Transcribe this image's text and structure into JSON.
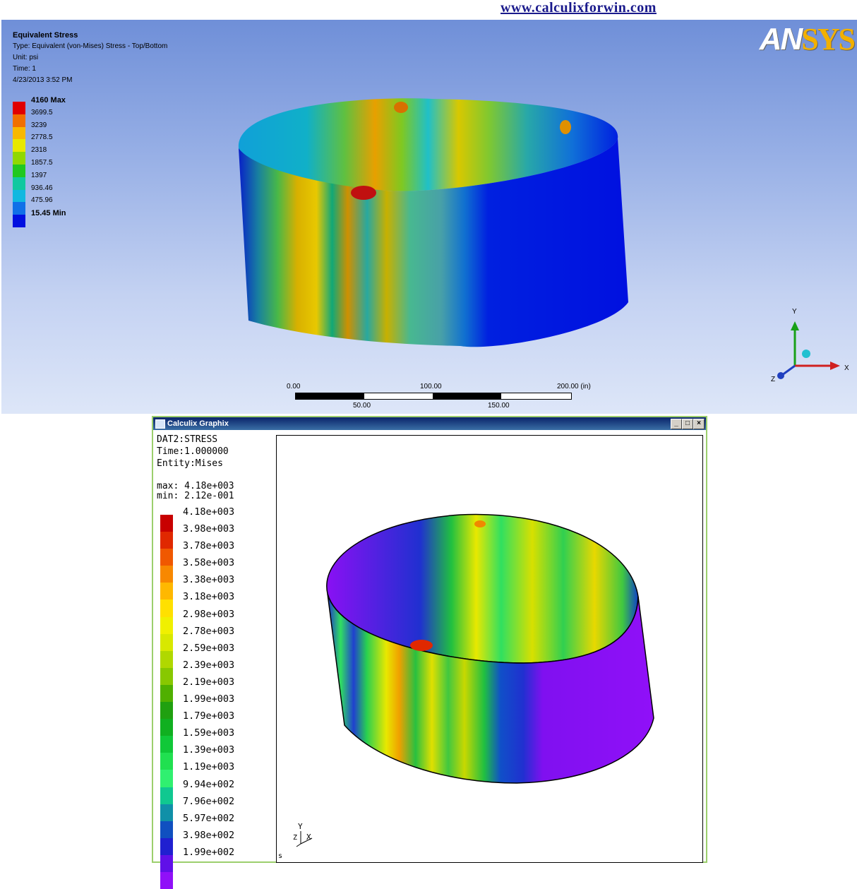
{
  "site_link": "www.calculixforwin.com",
  "ansys": {
    "title": "Equivalent Stress",
    "type_line": "Type: Equivalent (von-Mises) Stress - Top/Bottom",
    "unit_line": "Unit: psi",
    "time_line": "Time: 1",
    "date_line": "4/23/2013 3:52 PM",
    "logo_an": "AN",
    "logo_sys": "SYS",
    "legend": [
      {
        "label": "4160 Max",
        "color": "#e00000"
      },
      {
        "label": "3699.5",
        "color": "#f07000"
      },
      {
        "label": "3239",
        "color": "#f8b800"
      },
      {
        "label": "2778.5",
        "color": "#e8e800"
      },
      {
        "label": "2318",
        "color": "#90d800"
      },
      {
        "label": "1857.5",
        "color": "#20c820"
      },
      {
        "label": "1397",
        "color": "#10c8a0"
      },
      {
        "label": "936.46",
        "color": "#10b8e0"
      },
      {
        "label": "475.96",
        "color": "#1070e8"
      },
      {
        "label": "15.45 Min",
        "color": "#0010e0"
      }
    ],
    "scale": {
      "t0": "0.00",
      "t100": "100.00",
      "t200": "200.00 (in)",
      "t50": "50.00",
      "t150": "150.00"
    },
    "axis": {
      "x": "X",
      "y": "Y",
      "z": "Z"
    }
  },
  "calculix": {
    "window_title": "Calculix Graphix",
    "info_dataset": "DAT2:STRESS",
    "info_time": "Time:1.000000",
    "info_entity": "Entity:Mises",
    "max_line": "max: 4.18e+003",
    "min_line": "min: 2.12e-001",
    "legend": [
      {
        "label": "4.18e+003",
        "color": "#c80000"
      },
      {
        "label": "3.98e+003",
        "color": "#e02800"
      },
      {
        "label": "3.78e+003",
        "color": "#f05800"
      },
      {
        "label": "3.58e+003",
        "color": "#f88800"
      },
      {
        "label": "3.38e+003",
        "color": "#ffb800"
      },
      {
        "label": "3.18e+003",
        "color": "#ffe000"
      },
      {
        "label": "2.98e+003",
        "color": "#f0f000"
      },
      {
        "label": "2.78e+003",
        "color": "#d8e800"
      },
      {
        "label": "2.59e+003",
        "color": "#b0d800"
      },
      {
        "label": "2.39e+003",
        "color": "#88c800"
      },
      {
        "label": "2.19e+003",
        "color": "#50b000"
      },
      {
        "label": "1.99e+003",
        "color": "#20a010"
      },
      {
        "label": "1.79e+003",
        "color": "#10b020"
      },
      {
        "label": "1.59e+003",
        "color": "#10c838"
      },
      {
        "label": "1.39e+003",
        "color": "#20e050"
      },
      {
        "label": "1.19e+003",
        "color": "#30f070"
      },
      {
        "label": "9.94e+002",
        "color": "#10c890"
      },
      {
        "label": "7.96e+002",
        "color": "#1090a8"
      },
      {
        "label": "5.97e+002",
        "color": "#1050c0"
      },
      {
        "label": "3.98e+002",
        "color": "#2020d0"
      },
      {
        "label": "1.99e+002",
        "color": "#6010e8"
      },
      {
        "label": "",
        "color": "#9010f8"
      }
    ],
    "axis": {
      "x": "X",
      "y": "Y",
      "z": "Z"
    },
    "corner_mark": "s"
  }
}
